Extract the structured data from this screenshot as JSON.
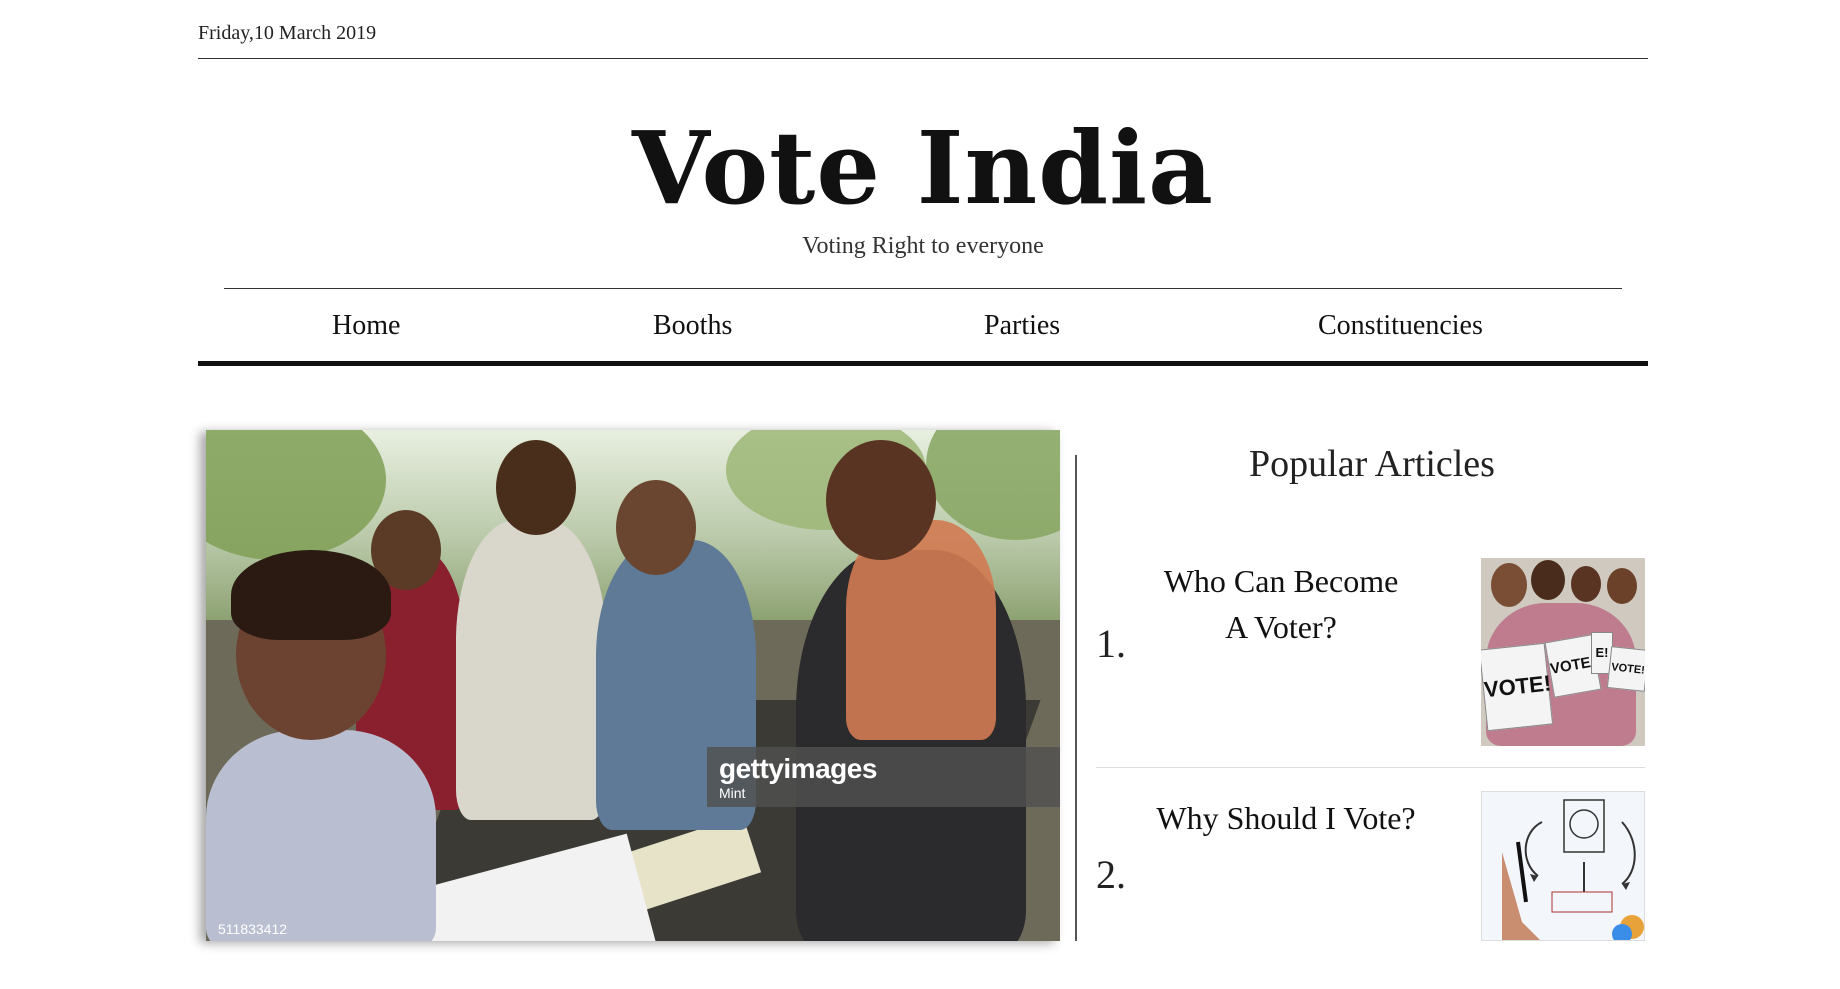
{
  "header": {
    "date": "Friday,10 March 2019",
    "site_title": "Vote India",
    "tagline": "Voting Right to everyone"
  },
  "nav": {
    "items": [
      {
        "label": "Home"
      },
      {
        "label": "Booths"
      },
      {
        "label": "Parties"
      },
      {
        "label": "Constituencies"
      }
    ]
  },
  "hero": {
    "watermark_brand": "gettyimages",
    "watermark_credit": "Mint",
    "image_id": "511833412"
  },
  "sidebar": {
    "title": "Popular Articles",
    "articles": [
      {
        "number": "1.",
        "title": "Who Can Become A Voter?"
      },
      {
        "number": "2.",
        "title": "Why Should I Vote?"
      }
    ],
    "thumb1_signs": [
      "VOTE!",
      "VOTE!",
      "E!",
      "VOTE!"
    ]
  },
  "colors": {
    "text": "#111111",
    "rule": "#333333",
    "background": "#ffffff"
  }
}
